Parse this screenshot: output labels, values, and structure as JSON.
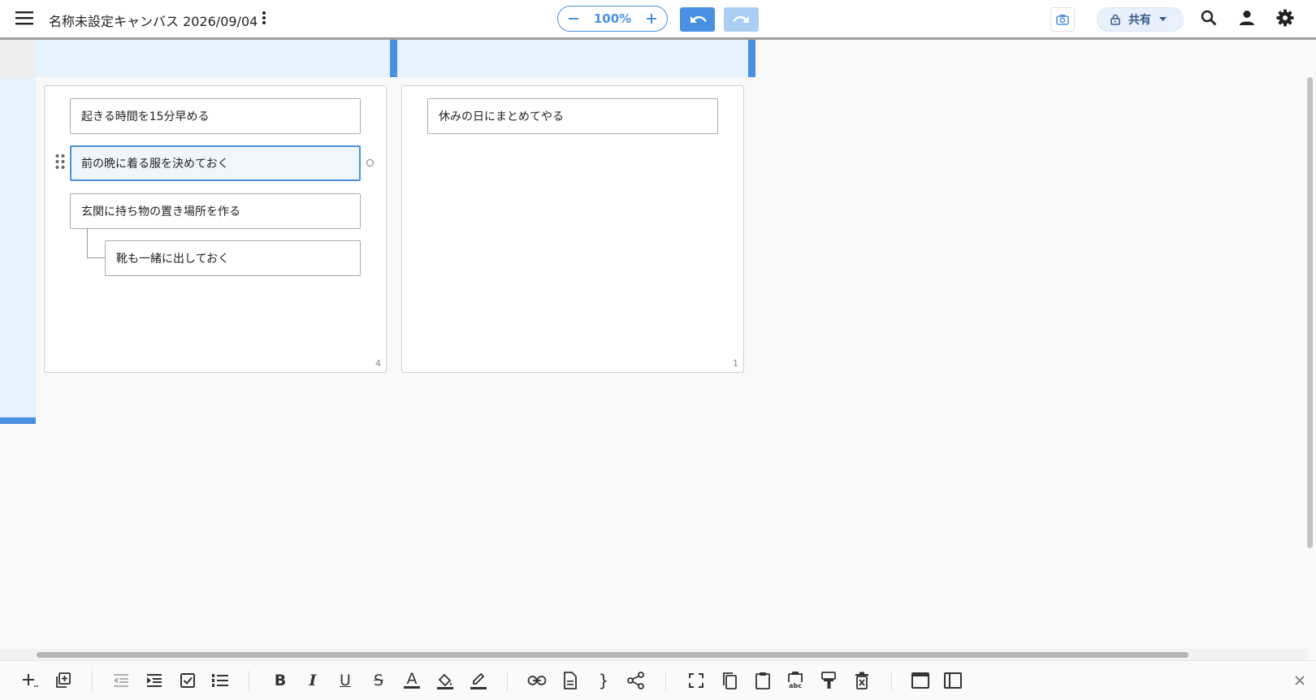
{
  "header": {
    "title": "名称未設定キャンバス 2026/09/04",
    "zoom_value": "100%",
    "share_label": "共有"
  },
  "board": {
    "groups": [
      {
        "count": "4",
        "cards": [
          {
            "text": "起きる時間を15分早める"
          },
          {
            "text": "前の晩に着る服を決めておく"
          },
          {
            "text": "玄関に持ち物の置き場所を作る"
          },
          {
            "text": "靴も一緒に出しておく"
          }
        ]
      },
      {
        "count": "1",
        "cards": [
          {
            "text": "休みの日にまとめてやる"
          }
        ]
      }
    ]
  },
  "toolbar": {
    "bold": "B",
    "italic": "I",
    "underline": "U",
    "strikethrough": "S",
    "text_color": "A",
    "brace": "}",
    "paste_text_sub": "abc"
  },
  "colors": {
    "accent": "#4a90e2",
    "accent_light": "#e6f2fd",
    "redo_disabled": "#a9cdf3"
  }
}
